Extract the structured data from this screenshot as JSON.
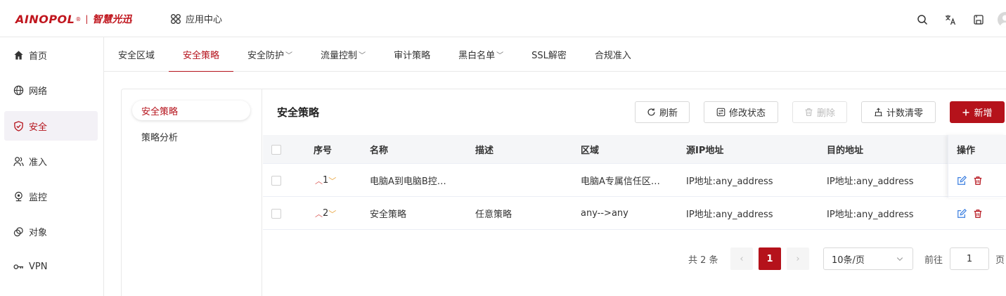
{
  "header": {
    "logo_text": "AINOPOL",
    "logo_reg": "®",
    "logo_sep": "|",
    "logo_cn": "智慧光迅",
    "app_center": "应用中心"
  },
  "sidebar": {
    "items": [
      {
        "label": "首页",
        "icon": "home-icon"
      },
      {
        "label": "网络",
        "icon": "globe-icon"
      },
      {
        "label": "安全",
        "icon": "shield-icon",
        "active": true
      },
      {
        "label": "准入",
        "icon": "users-icon"
      },
      {
        "label": "监控",
        "icon": "monitor-icon"
      },
      {
        "label": "对象",
        "icon": "object-icon"
      },
      {
        "label": "VPN",
        "icon": "key-icon"
      }
    ]
  },
  "tabs": [
    {
      "label": "安全区域"
    },
    {
      "label": "安全策略",
      "active": true
    },
    {
      "label": "安全防护",
      "dropdown": true
    },
    {
      "label": "流量控制",
      "dropdown": true
    },
    {
      "label": "审计策略"
    },
    {
      "label": "黑白名单",
      "dropdown": true
    },
    {
      "label": "SSL解密"
    },
    {
      "label": "合规准入"
    }
  ],
  "subnav": [
    {
      "label": "安全策略",
      "active": true
    },
    {
      "label": "策略分析"
    }
  ],
  "main": {
    "title": "安全策略",
    "buttons": {
      "refresh": "刷新",
      "modify_status": "修改状态",
      "delete": "删除",
      "clear_count": "计数清零",
      "add": "新增"
    }
  },
  "table": {
    "headers": {
      "seq": "序号",
      "name": "名称",
      "desc": "描述",
      "zone": "区域",
      "src_ip": "源IP地址",
      "dst_ip": "目的地址",
      "ops": "操作"
    },
    "rows": [
      {
        "seq": "1",
        "name": "电脑A到电脑B控…",
        "desc": "",
        "zone": "电脑A专属信任区…",
        "src_ip": "IP地址:any_address",
        "dst_ip": "IP地址:any_address"
      },
      {
        "seq": "2",
        "name": "安全策略",
        "desc": "任意策略",
        "zone": "any-->any",
        "src_ip": "IP地址:any_address",
        "dst_ip": "IP地址:any_address"
      }
    ]
  },
  "pagination": {
    "total": "共 2 条",
    "current": "1",
    "page_size": "10条/页",
    "goto_label": "前往",
    "goto_value": "1",
    "page_label": "页"
  },
  "colors": {
    "brand": "#b5121b",
    "active_bg": "#f3f1f6"
  }
}
